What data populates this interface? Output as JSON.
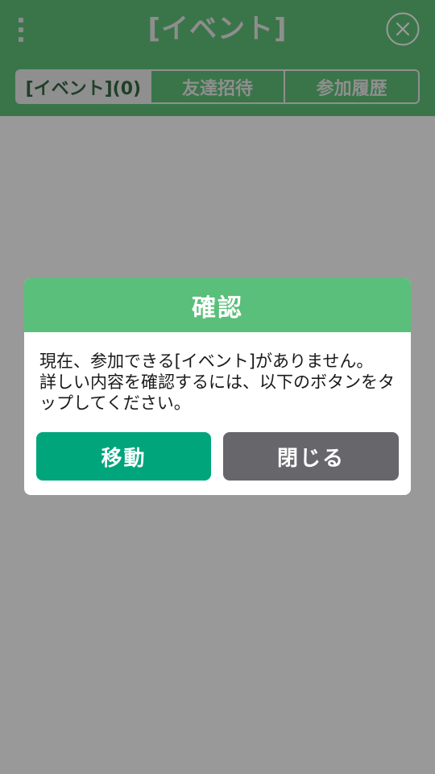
{
  "header": {
    "title": "[イベント]"
  },
  "tabs": [
    {
      "label": "[イベント](0)",
      "active": true
    },
    {
      "label": "友達招待",
      "active": false
    },
    {
      "label": "参加履歴",
      "active": false
    }
  ],
  "dialog": {
    "title": "確認",
    "message": "現在、参加できる[イベント]がありません。\n詳しい内容を確認するには、以下のボタンをタップしてください。",
    "move_label": "移動",
    "close_label": "閉じる"
  },
  "colors": {
    "dialog_header": "#5abf7a",
    "move_button": "#00a57c",
    "close_button": "#66666b",
    "overlay": "#999999"
  },
  "icons": {
    "menu": "more-vertical-icon",
    "close": "close-circle-icon"
  }
}
